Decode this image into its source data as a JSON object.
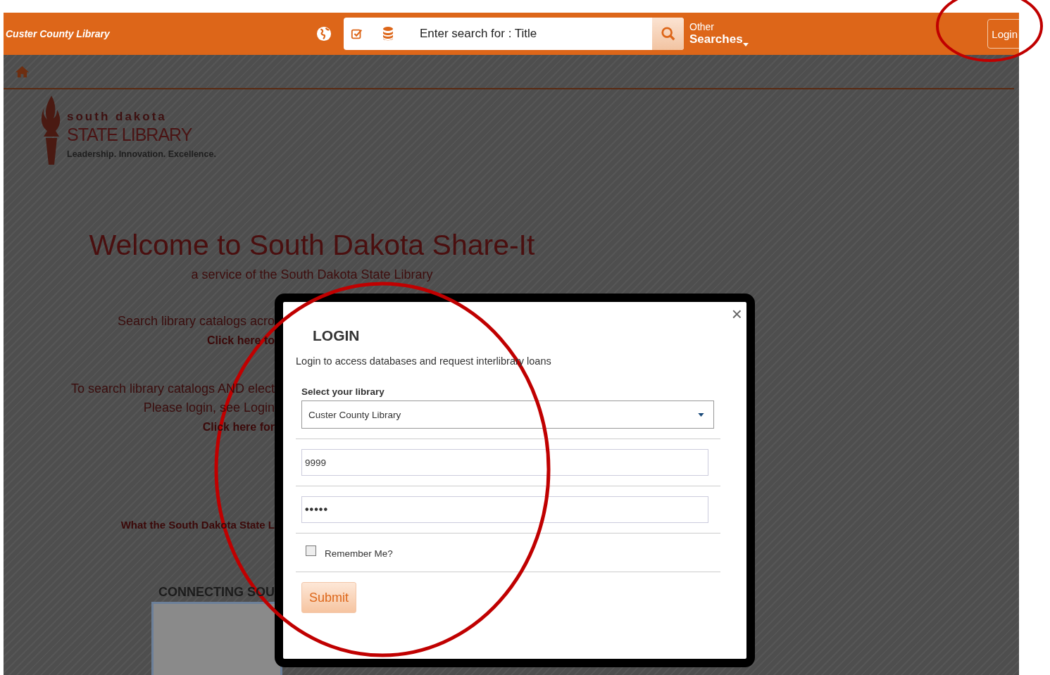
{
  "header": {
    "library_name": "Custer County Library",
    "search": {
      "value": "Enter search for : Title"
    },
    "other_searches": {
      "line_1": "Other",
      "line_2": "Searches"
    },
    "login_button": "Login"
  },
  "logo": {
    "line_1": "south dakota",
    "line_2": "STATE LIBRARY",
    "tagline": "Leadership. Innovation. Excellence."
  },
  "welcome": {
    "title": "Welcome to South Dakota Share-It",
    "subtitle": "a service of the South Dakota State Library"
  },
  "intro_blocks": [
    [
      {
        "text": "Search library catalogs acro",
        "bold": false
      },
      {
        "text": "Click here to",
        "bold": true
      }
    ],
    [
      {
        "text": "To search library catalogs AND elect",
        "bold": false
      },
      {
        "text": "Please login, see Login",
        "bold": false
      },
      {
        "text": "Click here for",
        "bold": true
      }
    ],
    [
      {
        "text": "What the South Dakota State L",
        "bold": true
      }
    ]
  ],
  "section_heading": "CONNECTING SOU",
  "modal": {
    "close": "×",
    "title": "LOGIN",
    "intro": "Login to access databases and request interlibrary loans",
    "library_label": "Select your library",
    "library_value": "Custer County Library",
    "username_value": "9999",
    "password_value": "•••••",
    "remember": {
      "label": "Remember Me?",
      "checked": false
    },
    "submit": "Submit"
  }
}
